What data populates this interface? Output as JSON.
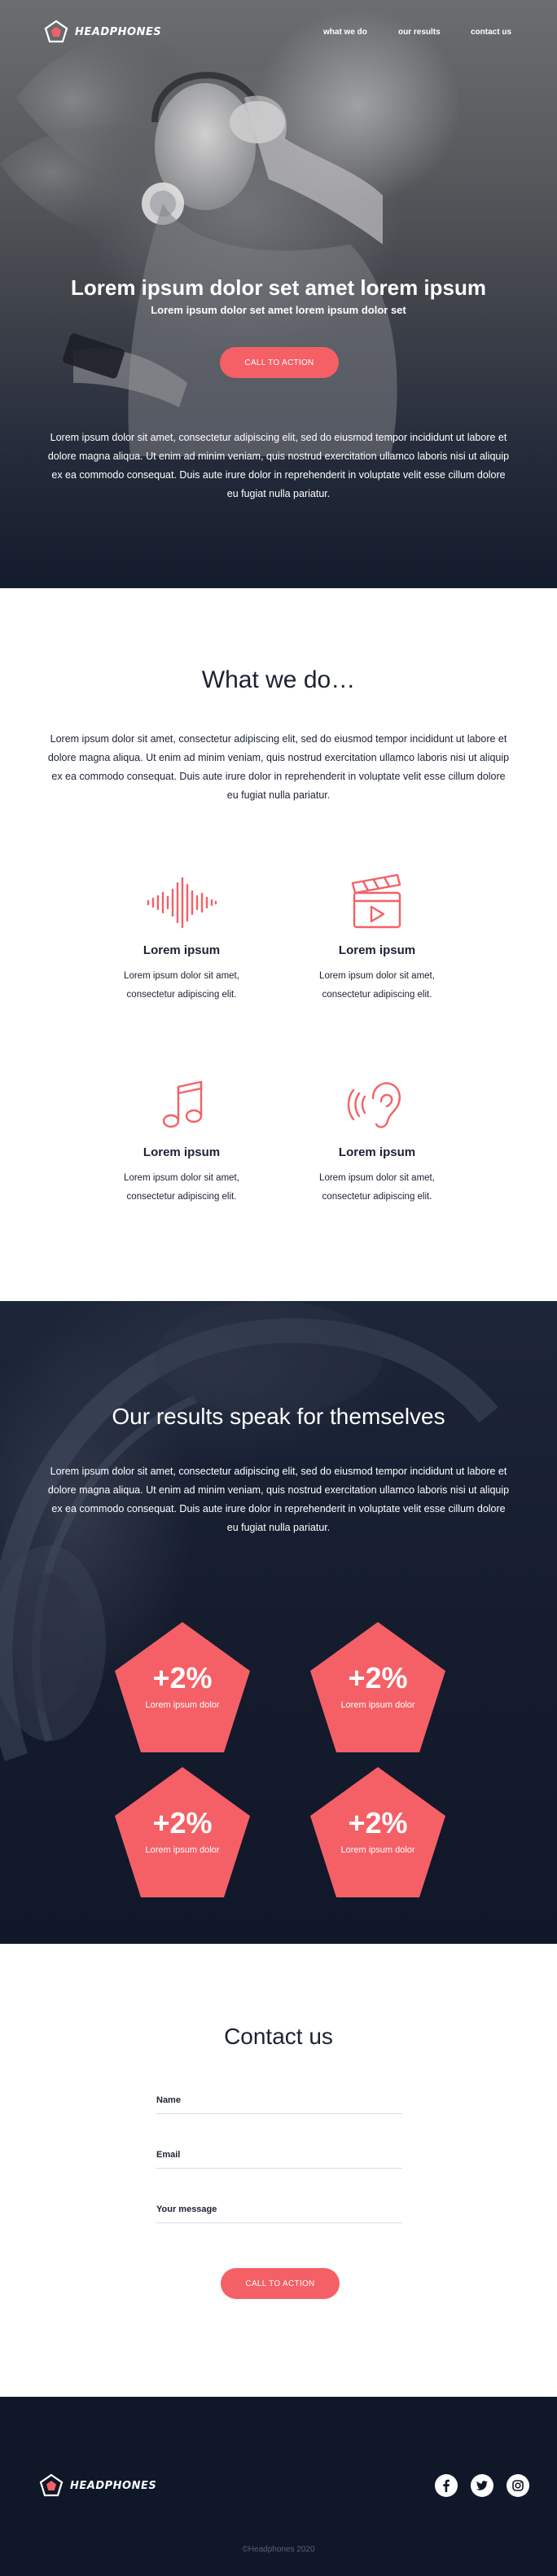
{
  "brand": {
    "name": "Headphones"
  },
  "nav": {
    "items": [
      "what we do",
      "our results",
      "contact us"
    ]
  },
  "hero": {
    "title": "Lorem ipsum dolor set amet lorem ipsum",
    "subtitle": "Lorem ipsum dolor set amet lorem ipsum dolor set",
    "cta": "CALL TO ACTION",
    "body": "Lorem ipsum dolor sit amet, consectetur adipiscing elit, sed do eiusmod tempor incididunt ut labore et dolore magna aliqua. Ut enim ad minim veniam, quis nostrud exercitation ullamco laboris nisi ut aliquip ex ea commodo consequat. Duis aute irure dolor in reprehenderit in voluptate velit esse cillum dolore eu fugiat nulla pariatur."
  },
  "what_we_do": {
    "title": "What we do…",
    "body": "Lorem ipsum dolor sit amet, consectetur adipiscing elit, sed do eiusmod tempor incididunt ut labore et dolore magna aliqua. Ut enim ad minim veniam, quis nostrud exercitation ullamco laboris nisi ut aliquip ex ea commodo consequat. Duis aute irure dolor in reprehenderit in voluptate velit esse cillum dolore eu fugiat nulla pariatur.",
    "features": [
      {
        "icon": "sound-wave-icon",
        "title": "Lorem ipsum",
        "text": "Lorem ipsum dolor sit amet, consectetur adipiscing elit."
      },
      {
        "icon": "clapperboard-icon",
        "title": "Lorem ipsum",
        "text": "Lorem ipsum dolor sit amet, consectetur adipiscing elit."
      },
      {
        "icon": "music-note-icon",
        "title": "Lorem ipsum",
        "text": "Lorem ipsum dolor sit amet, consectetur adipiscing elit."
      },
      {
        "icon": "ear-sound-icon",
        "title": "Lorem ipsum",
        "text": "Lorem ipsum dolor sit amet, consectetur adipiscing elit."
      }
    ]
  },
  "results": {
    "title": "Our results speak for themselves",
    "body": "Lorem ipsum dolor sit amet, consectetur adipiscing elit, sed do eiusmod tempor incididunt ut labore et dolore magna aliqua. Ut enim ad minim veniam, quis nostrud exercitation ullamco laboris nisi ut aliquip ex ea commodo consequat. Duis aute irure dolor in reprehenderit in voluptate velit esse cillum dolore eu fugiat nulla pariatur.",
    "stats": [
      {
        "value": "+2%",
        "label": "Lorem ipsum dolor"
      },
      {
        "value": "+2%",
        "label": "Lorem ipsum dolor"
      },
      {
        "value": "+2%",
        "label": "Lorem ipsum dolor"
      },
      {
        "value": "+2%",
        "label": "Lorem ipsum dolor"
      }
    ]
  },
  "contact": {
    "title": "Contact us",
    "fields": [
      "Name",
      "Email",
      "Your message"
    ],
    "cta": "CALL TO ACTION"
  },
  "footer": {
    "socials": [
      "facebook-icon",
      "twitter-icon",
      "instagram-icon"
    ],
    "copyright": "©Headphones 2020"
  },
  "colors": {
    "accent": "#f46066",
    "dark_navy": "#0f1729",
    "text_dark": "#1b2233",
    "white": "#ffffff"
  }
}
